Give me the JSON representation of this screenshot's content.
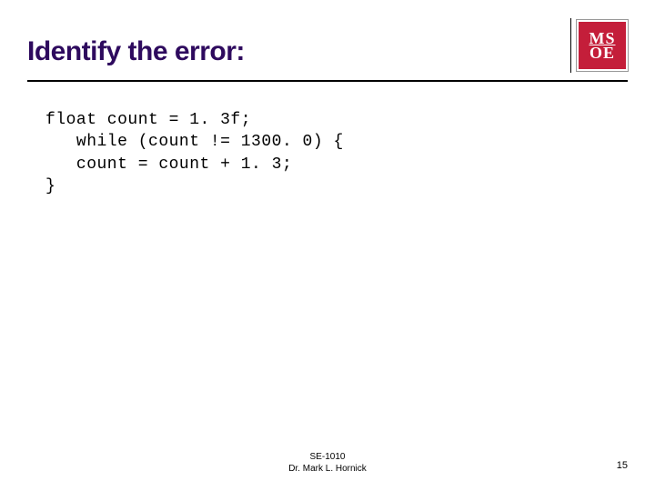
{
  "slide": {
    "title": "Identify the error:",
    "logo": {
      "line1": "MS",
      "line2": "OE"
    },
    "code": {
      "line1": "float count = 1. 3f;",
      "line2": "   while (count != 1300. 0) {",
      "line3": "   count = count + 1. 3;",
      "line4": "}"
    },
    "footer": {
      "course": "SE-1010",
      "author": "Dr. Mark L. Hornick"
    },
    "page_number": "15"
  }
}
